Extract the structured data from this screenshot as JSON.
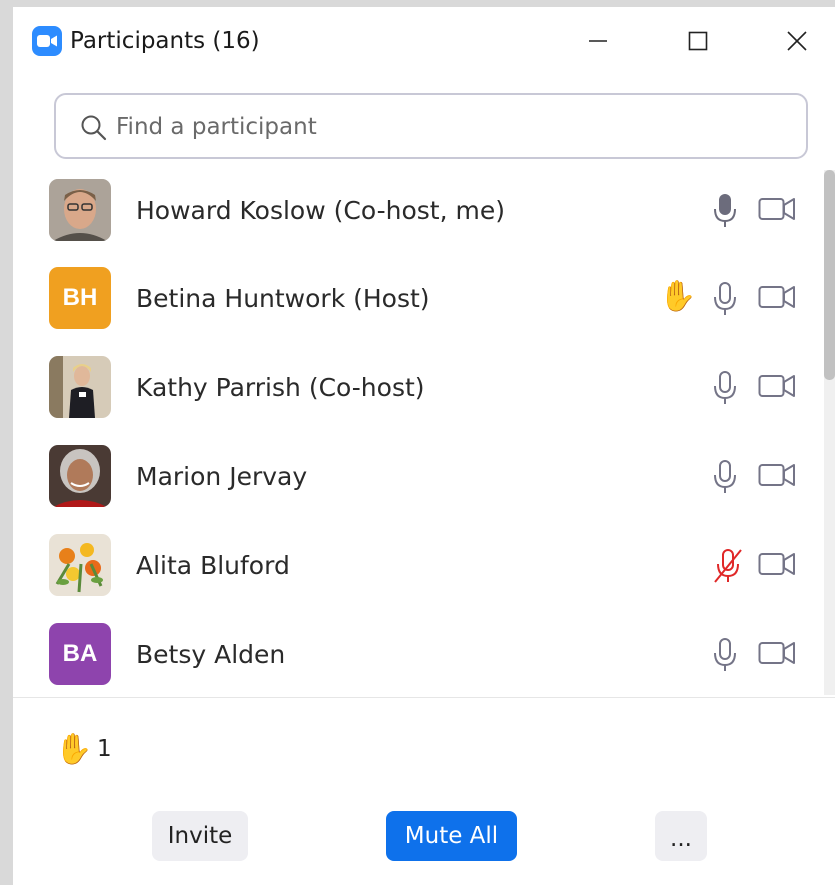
{
  "window": {
    "title": "Participants (16)",
    "app_icon": "video-camera-icon",
    "controls": [
      "minimize-icon",
      "maximize-icon",
      "close-icon"
    ]
  },
  "search": {
    "placeholder": "Find a participant",
    "value": ""
  },
  "participants": [
    {
      "name": "Howard Koslow (Co-host, me)",
      "avatar": "photo",
      "hand_raised": false,
      "mic": "on",
      "video": "off"
    },
    {
      "name": "Betina Huntwork (Host)",
      "avatar": "initials",
      "initials": "BH",
      "color": "#f0a020",
      "hand_raised": true,
      "hand_icon": "✋",
      "mic": "on",
      "video": "off"
    },
    {
      "name": "Kathy Parrish (Co-host)",
      "avatar": "photo",
      "hand_raised": false,
      "mic": "on",
      "video": "off"
    },
    {
      "name": "Marion Jervay",
      "avatar": "photo",
      "hand_raised": false,
      "mic": "on",
      "video": "off"
    },
    {
      "name": "Alita Bluford",
      "avatar": "photo",
      "hand_raised": false,
      "mic": "muted",
      "video": "off"
    },
    {
      "name": "Betsy Alden",
      "avatar": "initials",
      "initials": "BA",
      "color": "#8e44ad",
      "hand_raised": false,
      "mic": "on",
      "video": "off"
    }
  ],
  "footer": {
    "raised_hands_icon": "✋",
    "raised_hands_count": "1",
    "invite_label": "Invite",
    "mute_all_label": "Mute All",
    "more_label": "..."
  },
  "colors": {
    "accent": "#0e71eb",
    "app_icon": "#2d8cff",
    "muted": "#e02828",
    "icon_gray": "#747487"
  }
}
